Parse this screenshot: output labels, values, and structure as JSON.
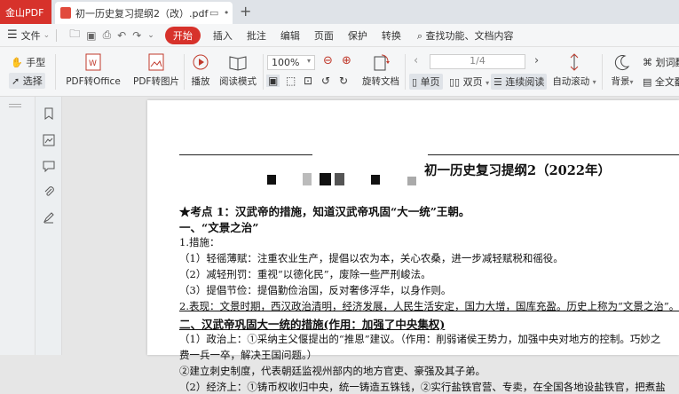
{
  "titlebar": {
    "app_name": "金山PDF",
    "doc_tab_title": "初一历史复习提纲2（改）.pdf",
    "new_tab": "+"
  },
  "menubar": {
    "file_label": "文件",
    "items": [
      "开始",
      "插入",
      "批注",
      "编辑",
      "页面",
      "保护",
      "转换"
    ],
    "search_label": "查找功能、文档内容"
  },
  "ribbon": {
    "hand_label": "手型",
    "select_label": "选择",
    "pdf_to_office": "PDF转Office",
    "pdf_to_image": "PDF转图片",
    "play": "播放",
    "read_mode": "阅读模式",
    "zoom_value": "100%",
    "rotate_doc": "旋转文档",
    "page_current": "1",
    "page_total": "/4",
    "single_page": "单页",
    "double_page": "双页",
    "continuous_read": "连续阅读",
    "auto_scroll": "自动滚动",
    "background": "背景",
    "translate_words": "划词翻",
    "full_text": "全文翻"
  },
  "document": {
    "title": "初一历史复习提纲2（2022年）",
    "lines": [
      {
        "text": "★考点 1：汉武帝的措施，知道汉武帝巩固“大一统”王朝。",
        "bold": true
      },
      {
        "text": "一、“文景之治”",
        "bold": true
      },
      {
        "text": "1.措施：",
        "bold": false
      },
      {
        "text": "（1）轻徭薄赋：注重农业生产，提倡以农为本，关心农桑，进一步减轻赋税和徭役。",
        "bold": false
      },
      {
        "text": "（2）减轻刑罚：重视“以德化民”，废除一些严刑峻法。",
        "bold": false
      },
      {
        "text": "（3）提倡节俭：提倡勤俭治国，反对奢侈浮华，以身作则。",
        "bold": false
      },
      {
        "text": "2.表现：文景时期，西汉政治清明，经济发展，人民生活安定，国力大增，国库充盈。历史上称为“文景之治”。",
        "bold": false
      },
      {
        "text": "二、汉武帝巩固大一统的措施(作用：加强了中央集权)",
        "bold": true
      },
      {
        "text": "（1）政治上：①采纳主父偃提出的“推恩”建议。（作用：削弱诸侯王势力，加强中央对地方的控制。巧妙之",
        "bold": false
      },
      {
        "text": "费一兵一卒，解决王国问题。）",
        "bold": false
      },
      {
        "text": "②建立刺史制度，代表朝廷监视州部内的地方官吏、豪强及其子弟。",
        "bold": false
      },
      {
        "text": "（2）经济上：①铸币权收归中央，统一铸造五铢钱，②实行盐铁官营、专卖，在全国各地设盐铁官，把煮盐",
        "bold": false
      }
    ]
  },
  "colors": {
    "brand_red": "#d7322b",
    "toolbar_bg": "#f5f6f7",
    "canvas_bg": "#e6e6e6"
  }
}
